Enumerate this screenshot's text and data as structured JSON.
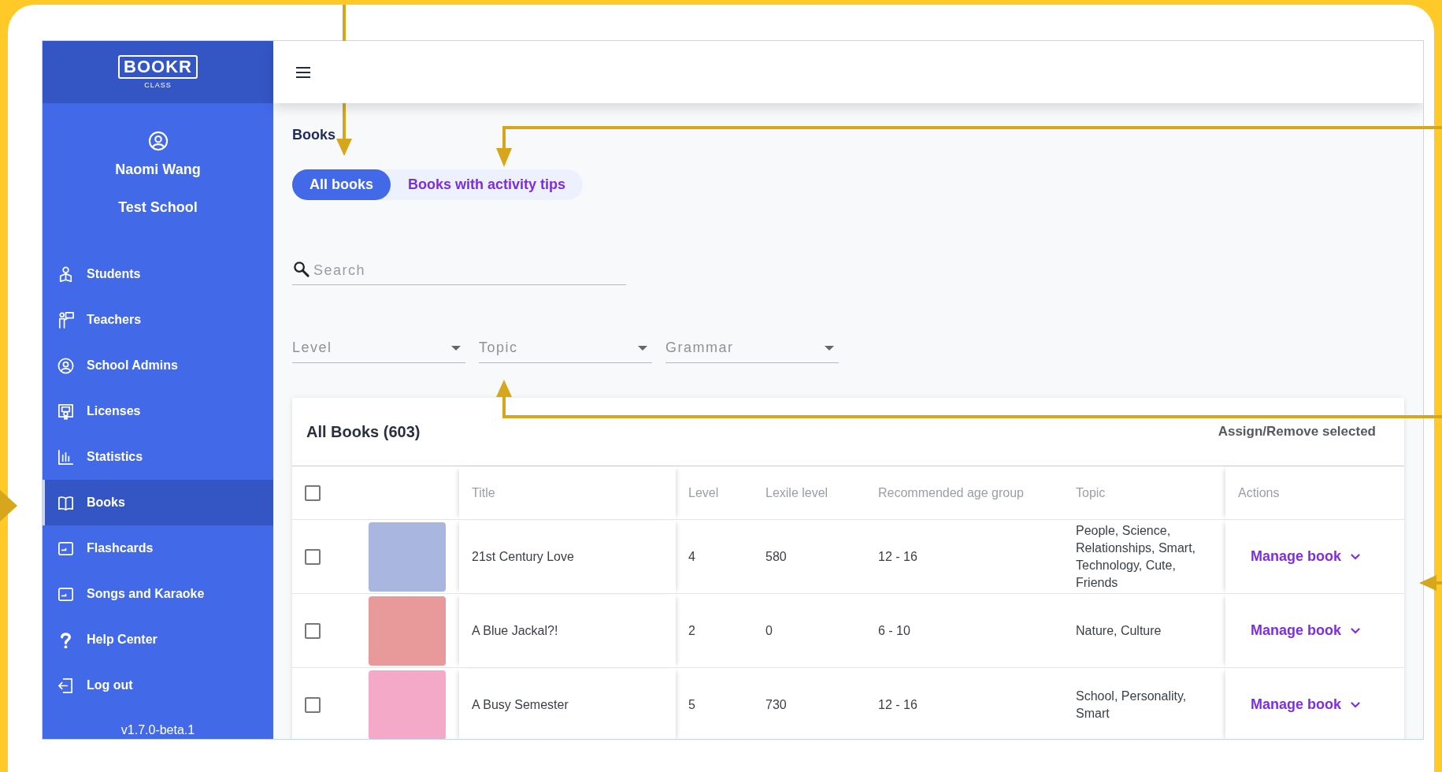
{
  "brand": {
    "logo": "BOOKR",
    "sublogo": "CLASS"
  },
  "user": {
    "name": "Naomi Wang",
    "school": "Test School"
  },
  "nav": [
    {
      "label": "Students",
      "kind": "students",
      "selected": false
    },
    {
      "label": "Teachers",
      "kind": "teachers",
      "selected": false
    },
    {
      "label": "School Admins",
      "kind": "admins",
      "selected": false
    },
    {
      "label": "Licenses",
      "kind": "licenses",
      "selected": false
    },
    {
      "label": "Statistics",
      "kind": "statistics",
      "selected": false
    },
    {
      "label": "Books",
      "kind": "books",
      "selected": true
    },
    {
      "label": "Flashcards",
      "kind": "cards",
      "selected": false
    },
    {
      "label": "Songs and Karaoke",
      "kind": "cards",
      "selected": false
    },
    {
      "label": "Help Center",
      "kind": "help",
      "selected": false
    },
    {
      "label": "Log out",
      "kind": "logout",
      "selected": false
    }
  ],
  "version": "v1.7.0-beta.1",
  "page": {
    "title": "Books"
  },
  "tabs": [
    {
      "label": "All books",
      "selected": true
    },
    {
      "label": "Books with activity tips",
      "selected": false
    }
  ],
  "search": {
    "placeholder": "Search"
  },
  "filters": [
    {
      "placeholder": "Level"
    },
    {
      "placeholder": "Topic"
    },
    {
      "placeholder": "Grammar"
    }
  ],
  "table": {
    "title": "All Books (603)",
    "bulk_action": "Assign/Remove selected",
    "select_all_checked": false,
    "columns": [
      "Title",
      "Level",
      "Lexile level",
      "Recommended age group",
      "Topic",
      "Actions"
    ],
    "rows": [
      {
        "checked": false,
        "title": "21st Century Love",
        "level": "4",
        "lexile": "580",
        "age": "12 - 16",
        "topic": "People, Science, Relationships, Smart, Technology, Cute, Friends",
        "action": "Manage book"
      },
      {
        "checked": false,
        "title": "A Blue Jackal?!",
        "level": "2",
        "lexile": "0",
        "age": "6 - 10",
        "topic": "Nature, Culture",
        "action": "Manage book"
      },
      {
        "checked": false,
        "title": "A Busy Semester",
        "level": "5",
        "lexile": "730",
        "age": "12 - 16",
        "topic": "School, Personality, Smart",
        "action": "Manage book"
      }
    ]
  }
}
